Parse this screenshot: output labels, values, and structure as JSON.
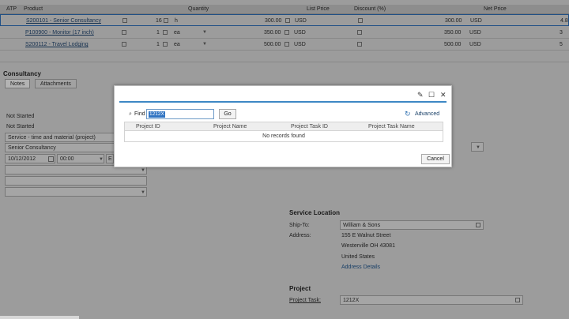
{
  "grid": {
    "headers": {
      "atp": "ATP",
      "product": "Product",
      "quantity": "Quantity",
      "list_price": "List Price",
      "discount": "Discount (%)",
      "net_price": "Net Price"
    },
    "rows": [
      {
        "product": "S200101 - Senior Consultancy",
        "qty": "16",
        "uom": "h",
        "list": "300.00",
        "cur": "USD",
        "net": "300.00",
        "net_cur": "USD",
        "extra": "4.8"
      },
      {
        "product": "P100900 - Monitor (17 inch)",
        "qty": "1",
        "uom": "ea",
        "list": "350.00",
        "cur": "USD",
        "net": "350.00",
        "net_cur": "USD",
        "extra": "3"
      },
      {
        "product": "S200112 - Travel Lodging",
        "qty": "1",
        "uom": "ea",
        "list": "500.00",
        "cur": "USD",
        "net": "500.00",
        "net_cur": "USD",
        "extra": "5"
      }
    ]
  },
  "details": {
    "title": "Consultancy",
    "tabs": [
      "Notes",
      "Attachments"
    ],
    "status1": "Not Started",
    "status2": "Not Started",
    "service_type": "Service - time and material (project)",
    "service_product": "Senior Consultancy",
    "date": "10/12/2012",
    "time": "00:00",
    "date_extra": "E"
  },
  "service_location": {
    "title": "Service Location",
    "ship_to_label": "Ship-To:",
    "ship_to": "William & Sons",
    "address_label": "Address:",
    "address_lines": [
      "155 E Walnut Street",
      "Westerville OH  43081",
      "United States"
    ],
    "address_details": "Address Details"
  },
  "project": {
    "title": "Project",
    "task_label": "Project Task:",
    "task_value": "1212X"
  },
  "modal": {
    "find_label": "Find",
    "find_value": "1212X",
    "go_label": "Go",
    "advanced_label": "Advanced",
    "columns": [
      "Project ID",
      "Project Name",
      "Project Task ID",
      "Project Task Name"
    ],
    "empty_message": "No records found",
    "cancel_label": "Cancel"
  }
}
